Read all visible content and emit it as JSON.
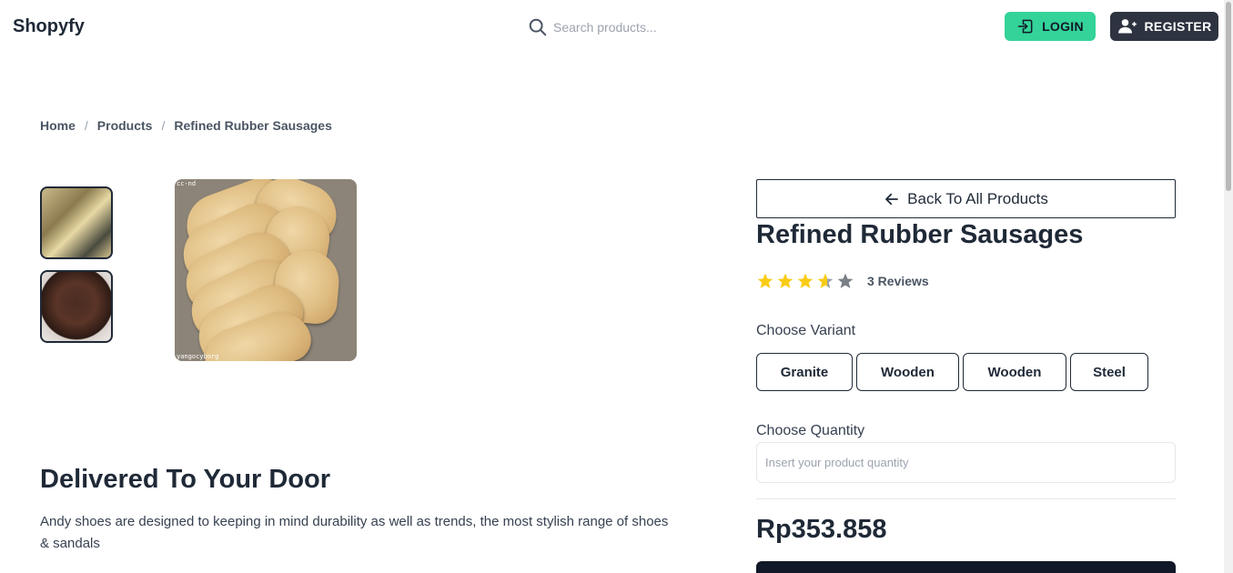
{
  "header": {
    "brand": "Shopyfy",
    "search_placeholder": "Search products...",
    "login_label": "LOGIN",
    "register_label": "REGISTER",
    "accent_color": "#34d399",
    "dark_color": "#2d3340"
  },
  "breadcrumb": {
    "items": [
      "Home",
      "Products",
      "Refined Rubber Sausages"
    ],
    "separator": "/"
  },
  "gallery": {
    "main_tag_top": "cc-nd",
    "main_tag_bottom": "yangocyborg",
    "thumbnails": [
      {
        "icon": "kitchen-photo"
      },
      {
        "icon": "chocolate-bowl-photo"
      }
    ]
  },
  "product": {
    "back_label": "Back To All Products",
    "title": "Refined Rubber Sausages",
    "rating": 4,
    "rating_max": 5,
    "reviews_label": "3 Reviews",
    "variant_label": "Choose Variant",
    "variants": [
      "Granite",
      "Wooden",
      "Wooden",
      "Steel"
    ],
    "quantity_label": "Choose Quantity",
    "quantity_placeholder": "Insert your product quantity",
    "price": "Rp353.858",
    "star_color": "#facc15"
  },
  "info": {
    "title": "Delivered To Your Door",
    "text": "Andy shoes are designed to keeping in mind durability as well as trends, the most stylish range of shoes & sandals"
  }
}
